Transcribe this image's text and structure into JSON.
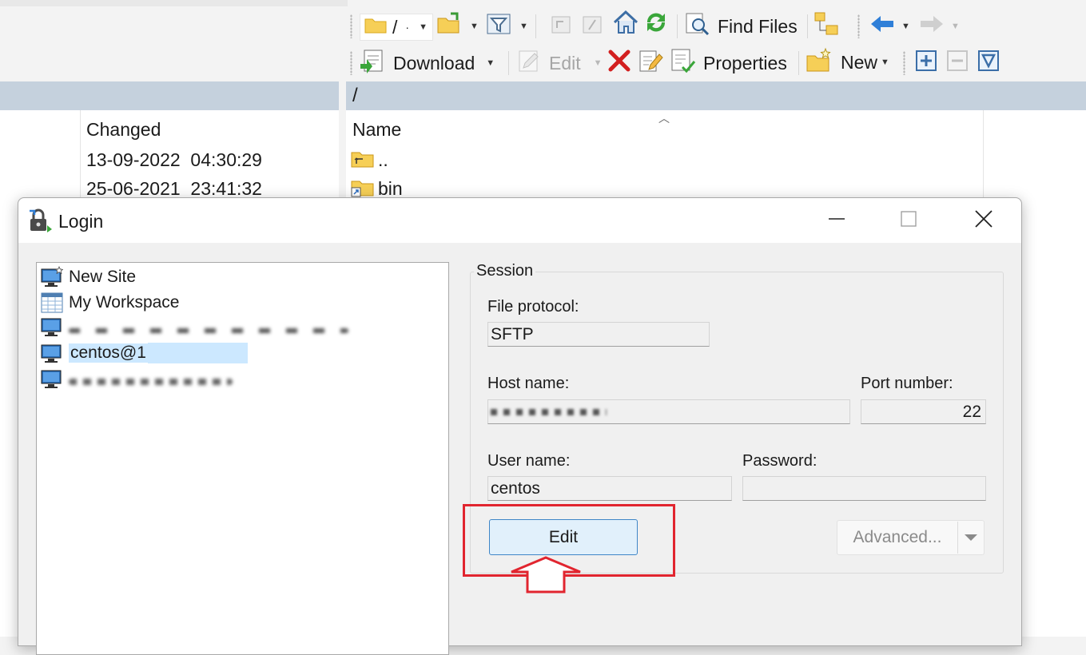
{
  "toolbar": {
    "path_label": "/",
    "find_files": "Find Files",
    "download": "Download",
    "edit": "Edit",
    "properties": "Properties",
    "new": "New"
  },
  "left_pane": {
    "header": "Changed",
    "rows": [
      {
        "changed": "13-09-2022  04:30:29"
      },
      {
        "changed": "25-06-2021  23:41:32"
      }
    ]
  },
  "right_pane": {
    "path": "/",
    "header": "Name",
    "rows": [
      {
        "name": ".."
      },
      {
        "name": "bin"
      }
    ]
  },
  "dialog": {
    "title": "Login",
    "sites": [
      {
        "label": "New Site",
        "icon": "new-site-icon"
      },
      {
        "label": "My Workspace",
        "icon": "workspace-icon"
      },
      {
        "label": "",
        "icon": "computer-icon"
      },
      {
        "label": "centos@1",
        "icon": "computer-icon",
        "selected": true
      },
      {
        "label": "",
        "icon": "computer-icon"
      }
    ],
    "session": {
      "group_label": "Session",
      "file_protocol_label": "File protocol:",
      "file_protocol_value": "SFTP",
      "host_name_label": "Host name:",
      "port_number_label": "Port number:",
      "port_number_value": "22",
      "user_name_label": "User name:",
      "user_name_value": "centos",
      "password_label": "Password:",
      "password_value": ""
    },
    "buttons": {
      "edit": "Edit",
      "advanced": "Advanced..."
    }
  },
  "colors": {
    "highlight": "#e1252f",
    "selection": "#cce8ff",
    "path_bar": "#c5d1dd"
  }
}
